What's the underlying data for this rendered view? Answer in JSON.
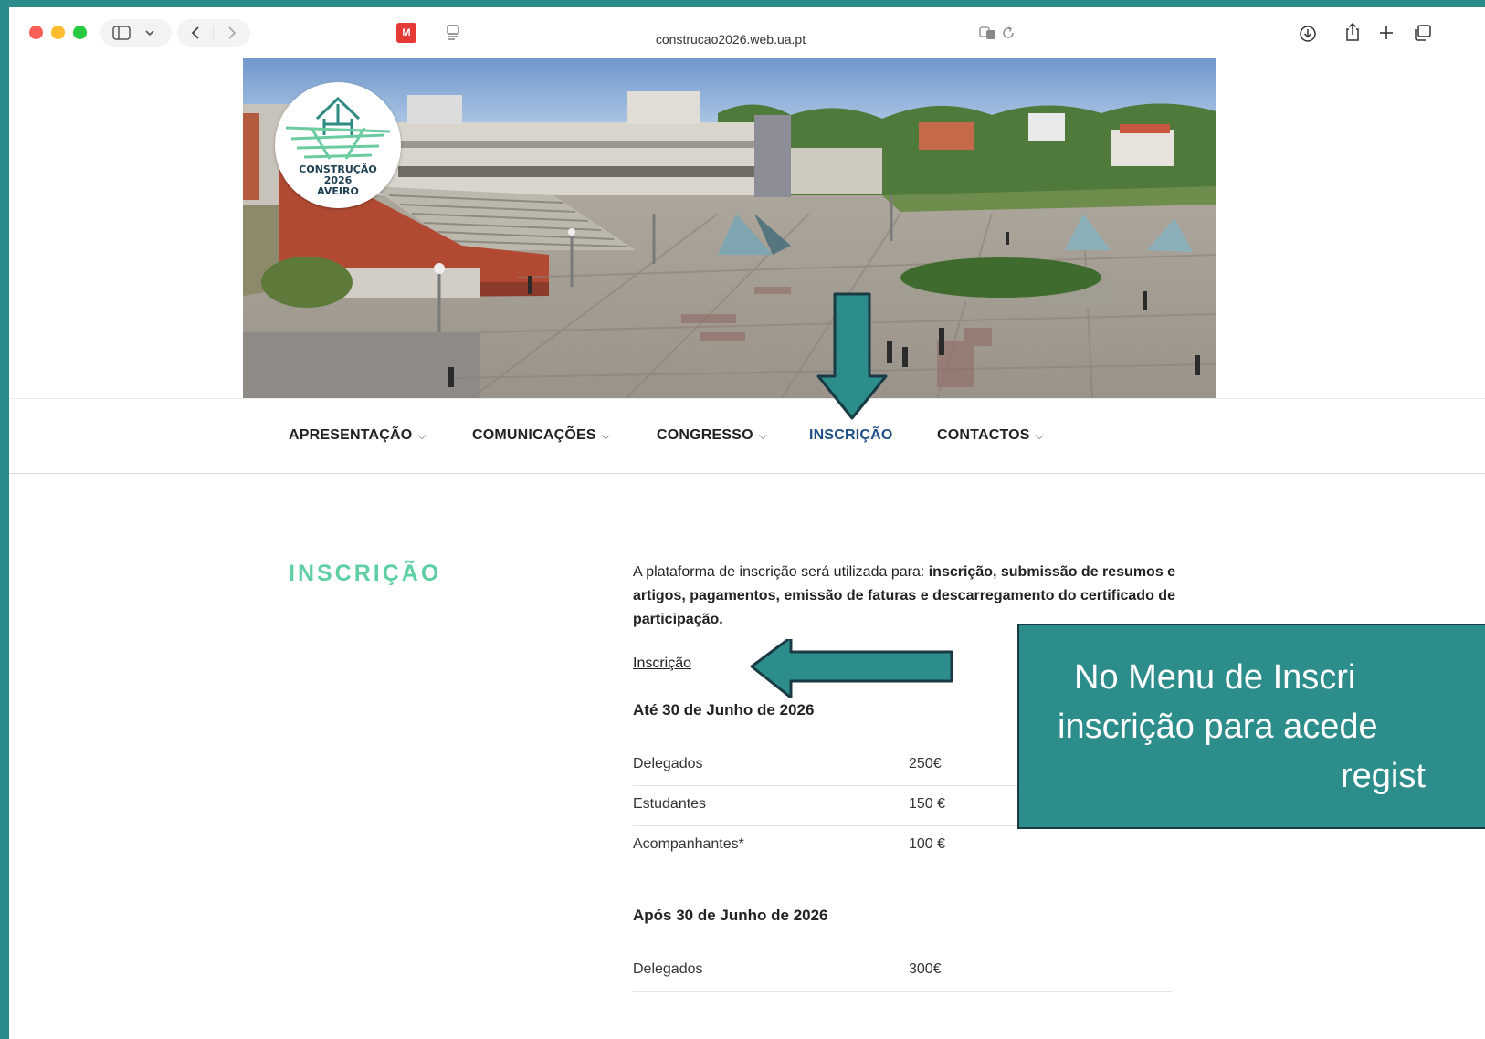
{
  "browser": {
    "url": "construcao2026.web.ua.pt",
    "icons": [
      "sidebar-icon",
      "chevron-down-icon",
      "back-icon",
      "forward-icon",
      "mcafee-icon",
      "reader-icon",
      "translate-icon",
      "reload-icon",
      "download-icon",
      "share-icon",
      "new-tab-icon",
      "tabs-overview-icon"
    ]
  },
  "logo": {
    "line1": "CONSTRUÇÃO",
    "line2": "2026",
    "line3": "AVEIRO"
  },
  "nav": {
    "items": [
      {
        "label": "APRESENTAÇÃO",
        "has_dropdown": true
      },
      {
        "label": "COMUNICAÇÕES",
        "has_dropdown": true
      },
      {
        "label": "CONGRESSO",
        "has_dropdown": true
      },
      {
        "label": "INSCRIÇÃO",
        "has_dropdown": false,
        "active": true
      },
      {
        "label": "CONTACTOS",
        "has_dropdown": true
      }
    ],
    "active_color": "#1e4f87"
  },
  "page": {
    "title": "INSCRIÇÃO",
    "title_color": "#5fcfa3",
    "intro_plain": "A plataforma de inscrição será utilizada para: ",
    "intro_bold": "inscrição, submissão de resumos e artigos, pagamentos, emissão de faturas e descarregamento do certificado de participação.",
    "registration_link": "Inscrição",
    "sections": [
      {
        "heading": "Até 30 de Junho de 2026",
        "rows": [
          {
            "label": "Delegados",
            "price": "250€"
          },
          {
            "label": "Estudantes",
            "price": "150 €"
          },
          {
            "label": "Acompanhantes*",
            "price": "100 €"
          }
        ]
      },
      {
        "heading": "Após 30 de Junho de 2026",
        "rows": [
          {
            "label": "Delegados",
            "price": "300€"
          }
        ]
      }
    ]
  },
  "annotation": {
    "color": "#2c8d8b",
    "line1": "No Menu de Inscri",
    "line2": "inscrição para acede",
    "line3": "regist"
  }
}
